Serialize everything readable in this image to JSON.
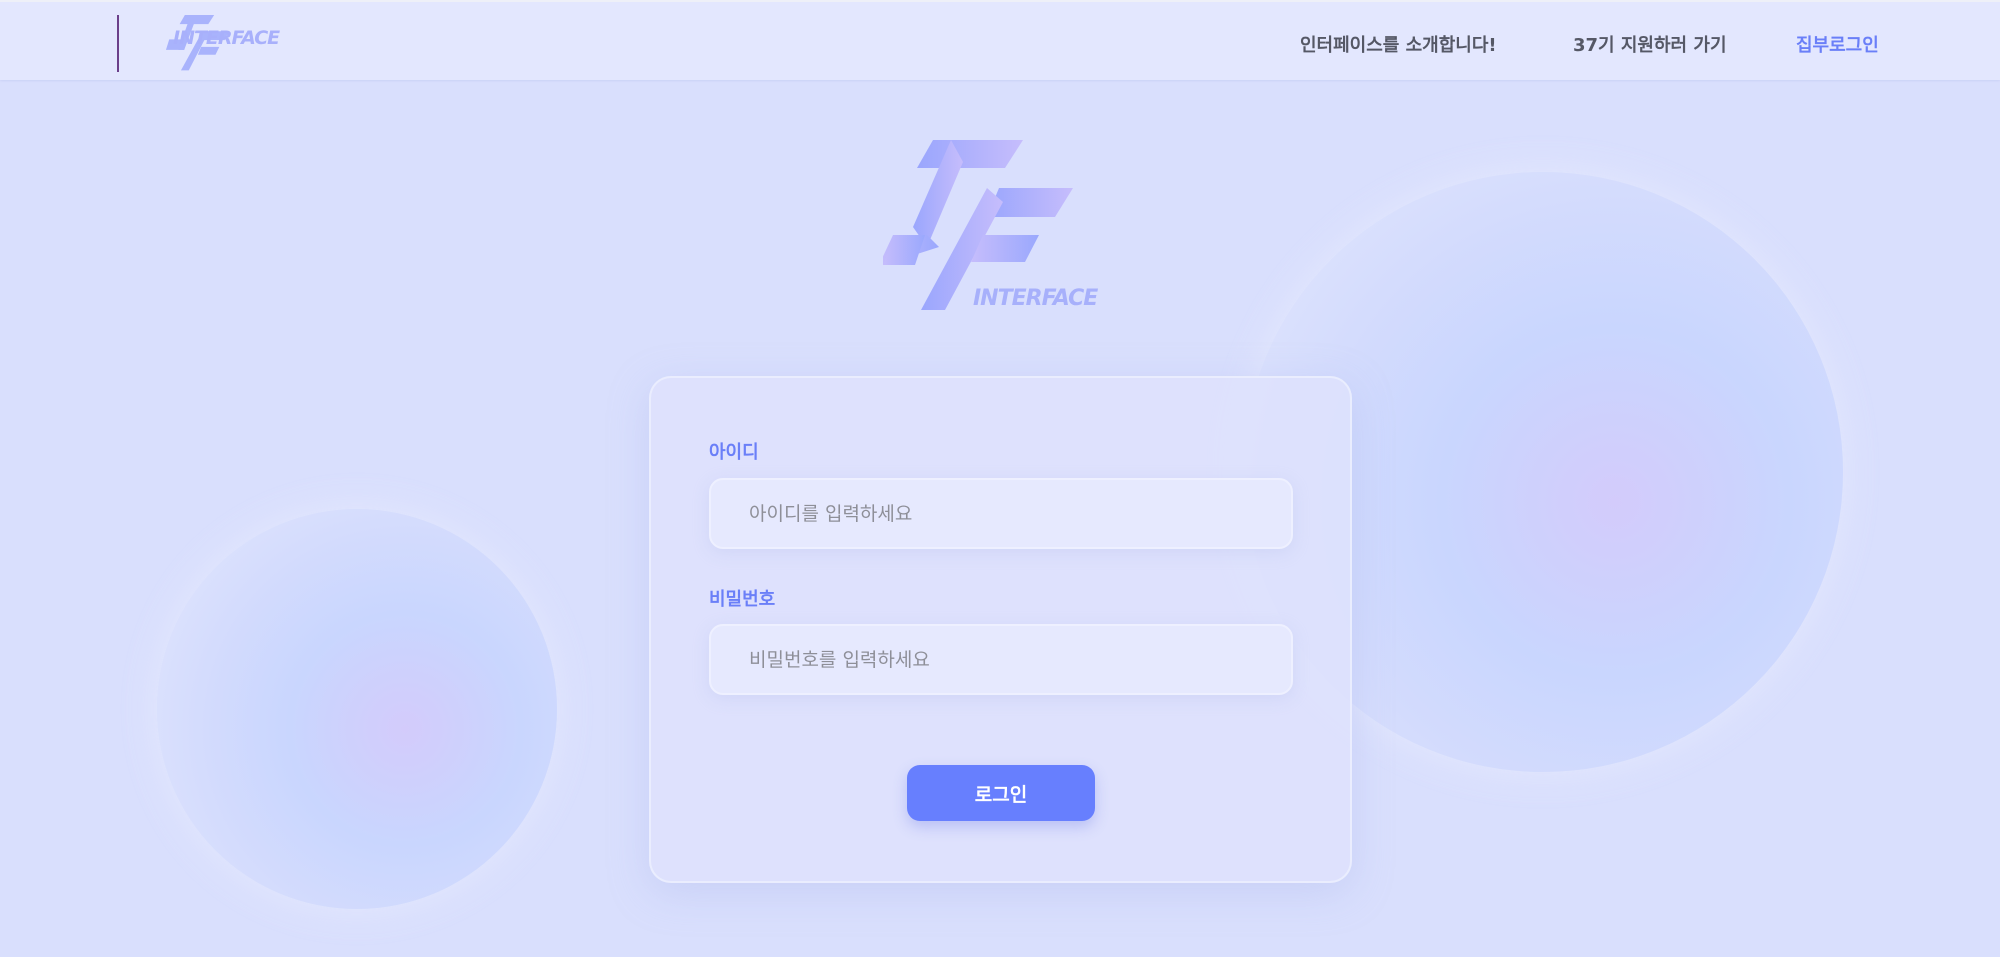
{
  "header": {
    "logo_text": "INTERFACE",
    "nav": [
      {
        "label": "인터페이스를 소개합니다!"
      },
      {
        "label": "37기 지원하러 가기"
      },
      {
        "label": "집부로그인",
        "active": true
      }
    ]
  },
  "hero": {
    "logo_text": "INTERFACE"
  },
  "form": {
    "id_label": "아이디",
    "id_placeholder": "아이디를 입력하세요",
    "id_value": "",
    "pw_label": "비밀번호",
    "pw_placeholder": "비밀번호를 입력하세요",
    "pw_value": "",
    "submit_label": "로그인"
  },
  "colors": {
    "accent": "#677ffe",
    "label": "#6a7ff8",
    "background": "#d9dffd"
  }
}
